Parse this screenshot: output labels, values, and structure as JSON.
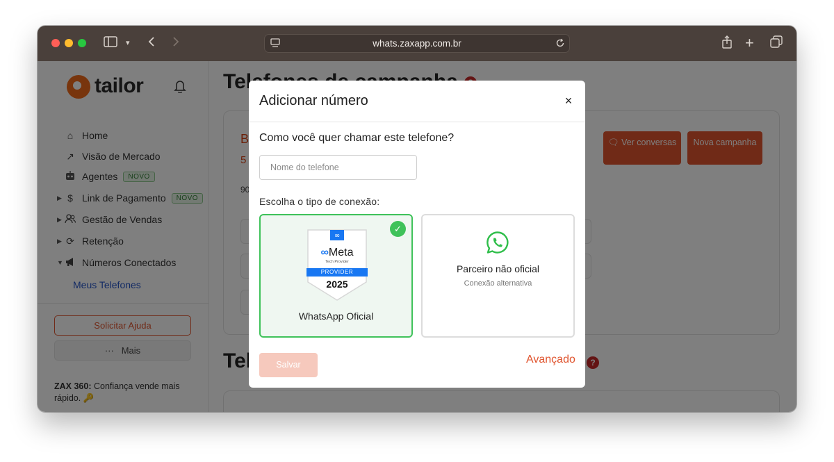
{
  "browser": {
    "url": "whats.zaxapp.com.br",
    "traffic_lights": [
      "#ff5f57",
      "#febc2e",
      "#28c840"
    ]
  },
  "sidebar": {
    "logo_text": "tailor",
    "items": [
      {
        "label": "Home",
        "icon": "home-icon"
      },
      {
        "label": "Visão de Mercado",
        "icon": "trend-icon"
      },
      {
        "label": "Agentes",
        "icon": "robot-icon",
        "badge": "NOVO"
      },
      {
        "label": "Link de Pagamento",
        "icon": "dollar-icon",
        "badge": "NOVO"
      },
      {
        "label": "Gestão de Vendas",
        "icon": "users-icon"
      },
      {
        "label": "Retenção",
        "icon": "refresh-icon"
      },
      {
        "label": "Números Conectados",
        "icon": "megaphone-icon"
      }
    ],
    "sub_item": "Meus Telefones",
    "help_button": "Solicitar Ajuda",
    "more_button": "Mais",
    "footer_bold": "ZAX 360:",
    "footer_text": "Confiança vende mais rápido. 🔑"
  },
  "main": {
    "title": "Telefones de campanha",
    "section2_title": "Tel",
    "card": {
      "red_letter": "B",
      "red_digit": "5",
      "small_digits": "90"
    },
    "buttons": {
      "ver_conversas": "Ver conversas",
      "nova_campanha": "Nova campanha"
    }
  },
  "modal": {
    "title": "Adicionar número",
    "close": "×",
    "question": "Como você quer chamar este telefone?",
    "input_placeholder": "Nome do telefone",
    "input_value": "",
    "connection_label": "Escolha o tipo de conexão:",
    "options": [
      {
        "title": "WhatsApp Oficial",
        "selected": true,
        "badge_brand": "Meta",
        "badge_tagline": "Tech Provider",
        "badge_provider": "PROVIDER",
        "badge_year": "2025"
      },
      {
        "title": "Parceiro não oficial",
        "subtitle": "Conexão alternativa",
        "selected": false,
        "icon": "whatsapp-icon"
      }
    ],
    "save_button": "Salvar",
    "advanced_link": "Avançado"
  },
  "colors": {
    "accent": "#e0542e",
    "success": "#3fc25a",
    "link": "#2454c8"
  }
}
